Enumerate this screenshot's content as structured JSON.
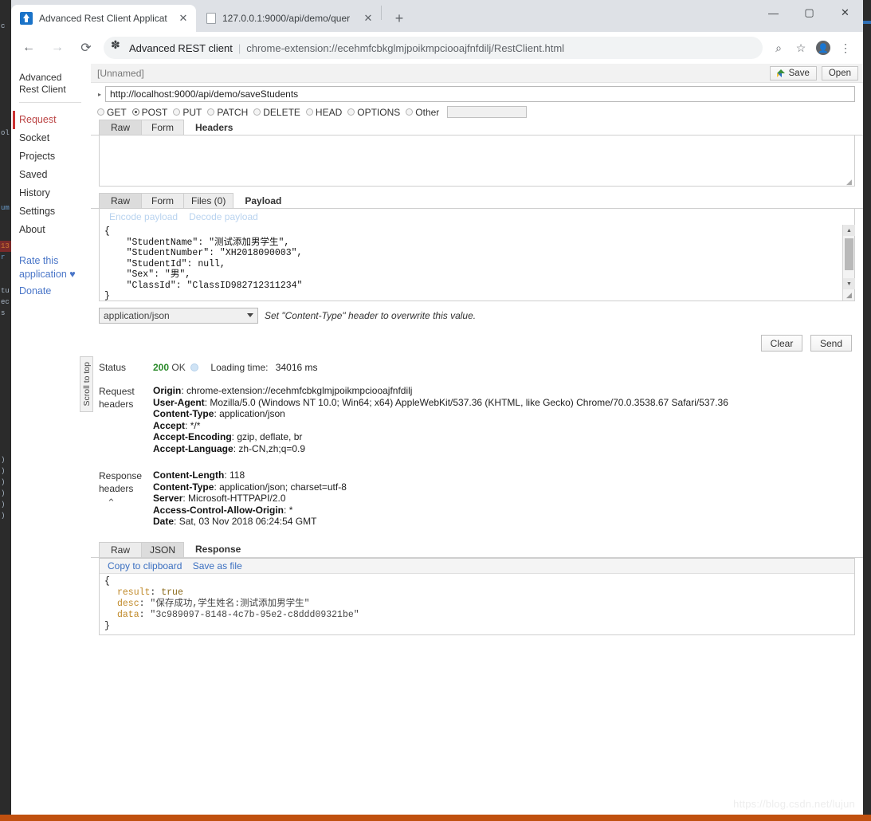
{
  "browser": {
    "tabs": [
      {
        "title": "Advanced Rest Client Applicat",
        "favicon": "arc-app-icon",
        "active": true,
        "close_label": "✕"
      },
      {
        "title": "127.0.0.1:9000/api/demo/quer",
        "favicon": "document-icon",
        "active": false,
        "close_label": "✕"
      }
    ],
    "new_tab_label": "+",
    "window_controls": {
      "minimize": "—",
      "maximize": "▢",
      "close": "✕"
    },
    "nav": {
      "back": "←",
      "forward": "→",
      "reload": "⟳"
    },
    "omnibox": {
      "extension_icon": "extension-puzzle-icon",
      "origin": "Advanced REST client",
      "divider": "|",
      "path": "chrome-extension://ecehmfcbkglmjpoikmpciooajfnfdilj/RestClient.html"
    },
    "omnibox_tools": {
      "zoom": "⌕",
      "bookmark": "☆",
      "profile": "●",
      "menu": "⋮"
    }
  },
  "arc": {
    "brand": "Advanced Rest Client",
    "nav_items": [
      {
        "label": "Request",
        "active": true
      },
      {
        "label": "Socket",
        "active": false
      },
      {
        "label": "Projects",
        "active": false
      },
      {
        "label": "Saved",
        "active": false
      },
      {
        "label": "History",
        "active": false
      },
      {
        "label": "Settings",
        "active": false
      },
      {
        "label": "About",
        "active": false
      }
    ],
    "links": [
      {
        "label": "Rate this"
      },
      {
        "label": "application ♥"
      },
      {
        "label": "Donate"
      }
    ],
    "namebar": {
      "request_name": "[Unnamed]",
      "save_label": "Save",
      "save_icon": "google-drive-icon",
      "open_label": "Open"
    },
    "url": {
      "caret": "▸",
      "value": "http://localhost:9000/api/demo/saveStudents"
    },
    "methods": [
      {
        "label": "GET",
        "selected": false
      },
      {
        "label": "POST",
        "selected": true
      },
      {
        "label": "PUT",
        "selected": false
      },
      {
        "label": "PATCH",
        "selected": false
      },
      {
        "label": "DELETE",
        "selected": false
      },
      {
        "label": "HEAD",
        "selected": false
      },
      {
        "label": "OPTIONS",
        "selected": false
      },
      {
        "label": "Other",
        "selected": false
      }
    ],
    "other_method_value": "",
    "header_tabs": [
      {
        "label": "Raw",
        "state": "selected"
      },
      {
        "label": "Form",
        "state": "normal"
      },
      {
        "label": "Headers",
        "state": "title"
      }
    ],
    "headers_text": "",
    "payload_tabs": [
      {
        "label": "Raw",
        "state": "selected"
      },
      {
        "label": "Form",
        "state": "normal"
      },
      {
        "label": "Files (0)",
        "state": "normal"
      },
      {
        "label": "Payload",
        "state": "title"
      }
    ],
    "payload_actions": [
      {
        "label": "Encode payload"
      },
      {
        "label": "Decode payload"
      }
    ],
    "payload_lines": [
      "{",
      "    \"StudentName\": \"测试添加男学生\",",
      "    \"StudentNumber\": \"XH2018090003\",",
      "    \"StudentId\": null,",
      "    \"Sex\": \"男\",",
      "    \"ClassId\": \"ClassID982712311234\"",
      "}"
    ],
    "payload_scroll": {
      "up": "▲",
      "down": "▼",
      "grip": "◢"
    },
    "content_type": {
      "value": "application/json",
      "note": "Set \"Content-Type\" header to overwrite this value."
    },
    "actions": [
      {
        "label": "Clear"
      },
      {
        "label": "Send"
      }
    ],
    "scroll_to_top": "Scroll to top",
    "status": {
      "label": "Status",
      "code": "200",
      "text": "OK",
      "loading_time_label": "Loading time:",
      "loading_time_value": "34016 ms"
    },
    "request_headers": {
      "label_line1": "Request",
      "label_line2": "headers",
      "rows": [
        {
          "name": "Origin",
          "value": "chrome-extension://ecehmfcbkglmjpoikmpciooajfnfdilj"
        },
        {
          "name": "User-Agent",
          "value": "Mozilla/5.0 (Windows NT 10.0; Win64; x64) AppleWebKit/537.36 (KHTML, like Gecko) Chrome/70.0.3538.67 Safari/537.36"
        },
        {
          "name": "Content-Type",
          "value": "application/json"
        },
        {
          "name": "Accept",
          "value": "*/*"
        },
        {
          "name": "Accept-Encoding",
          "value": "gzip, deflate, br"
        },
        {
          "name": "Accept-Language",
          "value": "zh-CN,zh;q=0.9"
        }
      ]
    },
    "response_headers": {
      "label_line1": "Response",
      "label_line2": "headers",
      "collapse_icon": "chevron-up-icon",
      "rows": [
        {
          "name": "Content-Length",
          "value": "118"
        },
        {
          "name": "Content-Type",
          "value": "application/json; charset=utf-8"
        },
        {
          "name": "Server",
          "value": "Microsoft-HTTPAPI/2.0"
        },
        {
          "name": "Access-Control-Allow-Origin",
          "value": "*"
        },
        {
          "name": "Date",
          "value": "Sat, 03 Nov 2018 06:24:54 GMT"
        }
      ]
    },
    "response_tabs": [
      {
        "label": "Raw",
        "state": "normal"
      },
      {
        "label": "JSON",
        "state": "selected"
      },
      {
        "label": "Response",
        "state": "title"
      }
    ],
    "response_links": [
      {
        "label": "Copy to clipboard"
      },
      {
        "label": "Save as file"
      }
    ],
    "response_json": {
      "open_brace": "{",
      "close_brace": "}",
      "rows": [
        {
          "key": "result",
          "sep": ":",
          "value": "true",
          "kind": "bool"
        },
        {
          "key": "desc",
          "sep": ":",
          "value": "\"保存成功,学生姓名:测试添加男学生\"",
          "kind": "string"
        },
        {
          "key": "data",
          "sep": ":",
          "value": "\"3c989097-8148-4c7b-95e2-c8ddd09321be\"",
          "kind": "string"
        }
      ]
    }
  },
  "watermark": "https://blog.csdn.net/lujun",
  "colors": {
    "accent_red": "#b44444",
    "link_blue": "#4a76c8",
    "status_green": "#2a8a2a",
    "chrome_tabstrip": "#dee1e6",
    "taskbar_orange": "#c0500f"
  }
}
